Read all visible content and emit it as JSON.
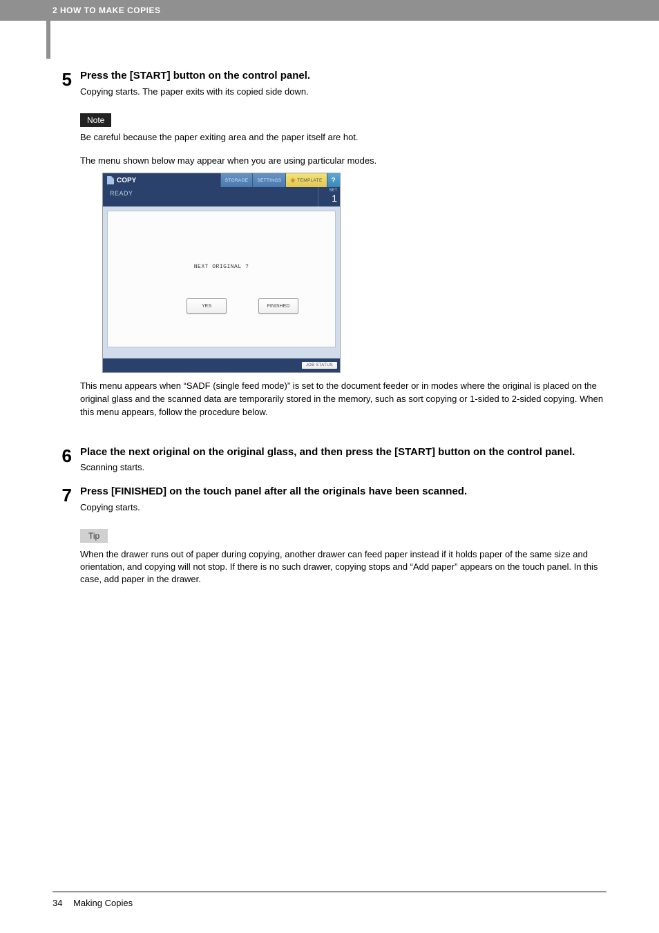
{
  "header": {
    "chapter": "2 HOW TO MAKE COPIES"
  },
  "steps": [
    {
      "number": "5",
      "title": "Press the [START] button on the control panel.",
      "text": "Copying starts. The paper exits with its copied side down.",
      "note_label": "Note",
      "note_text": "Be careful because the paper exiting area and the paper itself are hot.",
      "intro": "The menu shown below may appear when you are using particular modes.",
      "post_panel": "This menu appears when “SADF (single feed mode)” is set to the document feeder or in modes where the original is placed on the original glass and the scanned data are temporarily stored in the memory, such as sort copying or 1-sided to 2-sided copying. When this menu appears, follow the procedure below."
    },
    {
      "number": "6",
      "title": "Place the next original on the original glass, and then press the [START] button on the control panel.",
      "text": "Scanning starts."
    },
    {
      "number": "7",
      "title": "Press [FINISHED] on the touch panel after all the originals have been scanned.",
      "text": "Copying starts.",
      "tip_label": "Tip",
      "tip_text": "When the drawer runs out of paper during copying, another drawer can feed paper instead if it holds paper of the same size and orientation, and copying will not stop. If there is no such drawer, copying stops and “Add paper” appears on the touch panel. In this case, add paper in the drawer."
    }
  ],
  "panel": {
    "title": "COPY",
    "storage": "STORAGE",
    "settings": "SETTINGS",
    "template": "TEMPLATE",
    "help": "?",
    "ready": "READY",
    "set_label": "SET",
    "set_value": "1",
    "prompt": "NEXT ORIGINAL ?",
    "yes": "YES",
    "finished": "FINISHED",
    "job_status": "JOB STATUS"
  },
  "footer": {
    "page": "34",
    "title": "Making Copies"
  }
}
